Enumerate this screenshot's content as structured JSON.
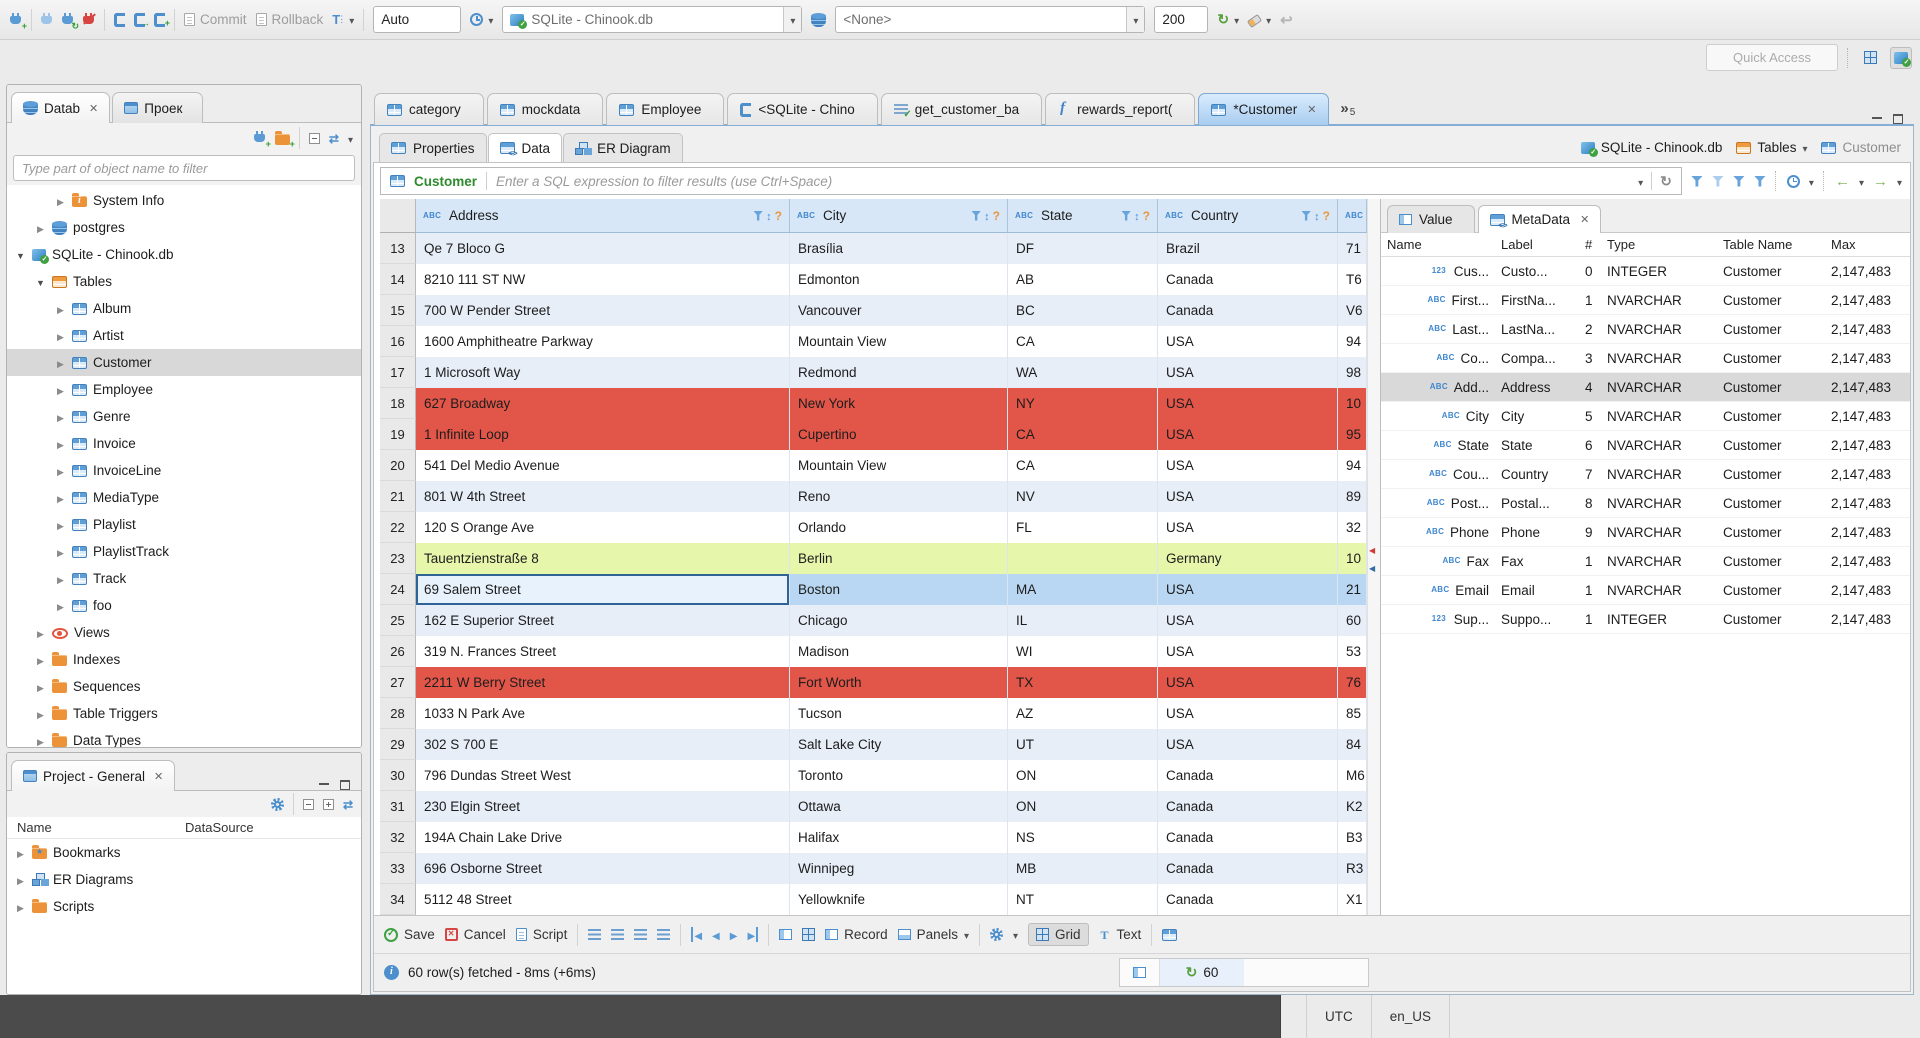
{
  "topbar": {
    "commit_label": "Commit",
    "rollback_label": "Rollback",
    "tx_mode_value": "Auto",
    "connection_value": "SQLite - Chinook.db",
    "schema_value": "<None>",
    "fetch_size_value": "200",
    "quick_access_placeholder": "Quick Access"
  },
  "left": {
    "tabs": [
      {
        "label": "Datab",
        "icon": "db",
        "cls": "active",
        "close": "✕"
      },
      {
        "label": "Проек",
        "icon": "win",
        "cls": "",
        "close": ""
      }
    ],
    "filter_placeholder": "Type part of object name to filter",
    "tree": [
      {
        "label": "System Info",
        "icon": "folder-info",
        "cls": "ind2",
        "exp": "collapsed"
      },
      {
        "label": "postgres",
        "icon": "db",
        "cls": "ind1",
        "exp": "collapsed"
      },
      {
        "label": "SQLite - Chinook.db",
        "icon": "dbfile",
        "cls": "ind0",
        "exp": "expanded"
      },
      {
        "label": "Tables",
        "icon": "folder-table",
        "cls": "ind1",
        "exp": "expanded"
      },
      {
        "label": "Album",
        "icon": "table",
        "cls": "ind2",
        "exp": "collapsed"
      },
      {
        "label": "Artist",
        "icon": "table",
        "cls": "ind2",
        "exp": "collapsed"
      },
      {
        "label": "Customer",
        "icon": "table",
        "cls": "ind2 selected",
        "exp": "collapsed"
      },
      {
        "label": "Employee",
        "icon": "table",
        "cls": "ind2",
        "exp": "collapsed"
      },
      {
        "label": "Genre",
        "icon": "table",
        "cls": "ind2",
        "exp": "collapsed"
      },
      {
        "label": "Invoice",
        "icon": "table",
        "cls": "ind2",
        "exp": "collapsed"
      },
      {
        "label": "InvoiceLine",
        "icon": "table",
        "cls": "ind2",
        "exp": "collapsed"
      },
      {
        "label": "MediaType",
        "icon": "table",
        "cls": "ind2",
        "exp": "collapsed"
      },
      {
        "label": "Playlist",
        "icon": "table",
        "cls": "ind2",
        "exp": "collapsed"
      },
      {
        "label": "PlaylistTrack",
        "icon": "table",
        "cls": "ind2",
        "exp": "collapsed"
      },
      {
        "label": "Track",
        "icon": "table",
        "cls": "ind2",
        "exp": "collapsed"
      },
      {
        "label": "foo",
        "icon": "table",
        "cls": "ind2",
        "exp": "collapsed"
      },
      {
        "label": "Views",
        "icon": "eye",
        "cls": "ind1",
        "exp": "collapsed"
      },
      {
        "label": "Indexes",
        "icon": "folder",
        "cls": "ind1",
        "exp": "collapsed"
      },
      {
        "label": "Sequences",
        "icon": "folder",
        "cls": "ind1",
        "exp": "collapsed"
      },
      {
        "label": "Table Triggers",
        "icon": "folder",
        "cls": "ind1",
        "exp": "collapsed"
      },
      {
        "label": "Data Types",
        "icon": "folder",
        "cls": "ind1",
        "exp": "collapsed"
      }
    ]
  },
  "project": {
    "tab_label": "Project - General",
    "tab_close": "✕",
    "col_name": "Name",
    "col_datasource": "DataSource",
    "items": [
      {
        "label": "Bookmarks",
        "icon": "folder-star",
        "exp": "collapsed"
      },
      {
        "label": "ER Diagrams",
        "icon": "diagram",
        "exp": "collapsed"
      },
      {
        "label": "Scripts",
        "icon": "folder",
        "exp": "collapsed"
      }
    ]
  },
  "editor": {
    "tabs": [
      {
        "label": "category",
        "icon": "table",
        "cls": "",
        "close": ""
      },
      {
        "label": "mockdata",
        "icon": "table",
        "cls": "",
        "close": ""
      },
      {
        "label": "Employee",
        "icon": "table",
        "cls": "",
        "close": ""
      },
      {
        "label": "<SQLite - Chino",
        "icon": "sql",
        "cls": "",
        "close": ""
      },
      {
        "label": "get_customer_ba",
        "icon": "script-check",
        "cls": "",
        "close": ""
      },
      {
        "label": "rewards_report(",
        "icon": "function",
        "cls": "",
        "close": ""
      },
      {
        "label": "*Customer",
        "icon": "table",
        "cls": "active",
        "close": "✕"
      }
    ],
    "overflow_count": "5",
    "subtabs": [
      {
        "label": "Properties",
        "icon": "table",
        "cls": ""
      },
      {
        "label": "Data",
        "icon": "data",
        "cls": "active"
      },
      {
        "label": "ER Diagram",
        "icon": "diagram",
        "cls": ""
      }
    ],
    "breadcrumb": [
      {
        "label": "SQLite - Chinook.db",
        "icon": "dbfile",
        "cls": "",
        "caretcls": ""
      },
      {
        "label": "Tables",
        "icon": "folder-table",
        "cls": "",
        "caretcls": "show"
      },
      {
        "label": "Customer",
        "icon": "table",
        "cls": "muted",
        "caretcls": ""
      }
    ]
  },
  "datagrid": {
    "entity_label": "Customer",
    "filter_placeholder": "Enter a SQL expression to filter results (use Ctrl+Space)",
    "columns": [
      {
        "label": "Address",
        "cls": "c-addr"
      },
      {
        "label": "City",
        "cls": "c-city"
      },
      {
        "label": "State",
        "cls": "c-state"
      },
      {
        "label": "Country",
        "cls": "c-country"
      },
      {
        "label": "",
        "cls": "c-postal nofilter"
      }
    ],
    "rows": [
      {
        "num": "13",
        "address": "Qe 7 Bloco G",
        "city": "Brasília",
        "state": "DF",
        "country": "Brazil",
        "postal": "71",
        "cls": "alt"
      },
      {
        "num": "14",
        "address": "8210 111 ST NW",
        "city": "Edmonton",
        "state": "AB",
        "country": "Canada",
        "postal": "T6",
        "cls": ""
      },
      {
        "num": "15",
        "address": "700 W Pender Street",
        "city": "Vancouver",
        "state": "BC",
        "country": "Canada",
        "postal": "V6",
        "cls": "alt"
      },
      {
        "num": "16",
        "address": "1600 Amphitheatre Parkway",
        "city": "Mountain View",
        "state": "CA",
        "country": "USA",
        "postal": "94",
        "cls": ""
      },
      {
        "num": "17",
        "address": "1 Microsoft Way",
        "city": "Redmond",
        "state": "WA",
        "country": "USA",
        "postal": "98",
        "cls": "alt"
      },
      {
        "num": "18",
        "address": "627 Broadway",
        "city": "New York",
        "state": "NY",
        "country": "USA",
        "postal": "10",
        "cls": "red"
      },
      {
        "num": "19",
        "address": "1 Infinite Loop",
        "city": "Cupertino",
        "state": "CA",
        "country": "USA",
        "postal": "95",
        "cls": "red"
      },
      {
        "num": "20",
        "address": "541 Del Medio Avenue",
        "city": "Mountain View",
        "state": "CA",
        "country": "USA",
        "postal": "94",
        "cls": ""
      },
      {
        "num": "21",
        "address": "801 W 4th Street",
        "city": "Reno",
        "state": "NV",
        "country": "USA",
        "postal": "89",
        "cls": "alt"
      },
      {
        "num": "22",
        "address": "120 S Orange Ave",
        "city": "Orlando",
        "state": "FL",
        "country": "USA",
        "postal": "32",
        "cls": ""
      },
      {
        "num": "23",
        "address": "Tauentzienstraße 8",
        "city": "Berlin",
        "state": "",
        "country": "Germany",
        "postal": "10",
        "cls": "green"
      },
      {
        "num": "24",
        "address": "69 Salem Street",
        "city": "Boston",
        "state": "MA",
        "country": "USA",
        "postal": "21",
        "cls": "sel"
      },
      {
        "num": "25",
        "address": "162 E Superior Street",
        "city": "Chicago",
        "state": "IL",
        "country": "USA",
        "postal": "60",
        "cls": "alt"
      },
      {
        "num": "26",
        "address": "319 N. Frances Street",
        "city": "Madison",
        "state": "WI",
        "country": "USA",
        "postal": "53",
        "cls": ""
      },
      {
        "num": "27",
        "address": "2211 W Berry Street",
        "city": "Fort Worth",
        "state": "TX",
        "country": "USA",
        "postal": "76",
        "cls": "red"
      },
      {
        "num": "28",
        "address": "1033 N Park Ave",
        "city": "Tucson",
        "state": "AZ",
        "country": "USA",
        "postal": "85",
        "cls": ""
      },
      {
        "num": "29",
        "address": "302 S 700 E",
        "city": "Salt Lake City",
        "state": "UT",
        "country": "USA",
        "postal": "84",
        "cls": "alt"
      },
      {
        "num": "30",
        "address": "796 Dundas Street West",
        "city": "Toronto",
        "state": "ON",
        "country": "Canada",
        "postal": "M6",
        "cls": ""
      },
      {
        "num": "31",
        "address": "230 Elgin Street",
        "city": "Ottawa",
        "state": "ON",
        "country": "Canada",
        "postal": "K2",
        "cls": "alt"
      },
      {
        "num": "32",
        "address": "194A Chain Lake Drive",
        "city": "Halifax",
        "state": "NS",
        "country": "Canada",
        "postal": "B3",
        "cls": ""
      },
      {
        "num": "33",
        "address": "696 Osborne Street",
        "city": "Winnipeg",
        "state": "MB",
        "country": "Canada",
        "postal": "R3",
        "cls": "alt"
      },
      {
        "num": "34",
        "address": "5112 48 Street",
        "city": "Yellowknife",
        "state": "NT",
        "country": "Canada",
        "postal": "X1",
        "cls": ""
      }
    ],
    "toolbar": {
      "save": "Save",
      "cancel": "Cancel",
      "script": "Script",
      "record": "Record",
      "panels": "Panels",
      "grid": "Grid",
      "text": "Text"
    },
    "status_message": "60 row(s) fetched - 8ms (+6ms)",
    "fetch_count": "60"
  },
  "metadata": {
    "tabs": [
      {
        "label": "Value",
        "icon": "panelv",
        "cls": "",
        "close": ""
      },
      {
        "label": "MetaData",
        "icon": "data",
        "cls": "active",
        "close": "✕"
      }
    ],
    "columns": {
      "name": "Name",
      "label": "Label",
      "num": "#",
      "type": "Type",
      "table": "Table Name",
      "max": "Max"
    },
    "rows": [
      {
        "icon": "num123",
        "name": "Cus...",
        "label": "Custo...",
        "num": "0",
        "type": "INTEGER",
        "table": "Customer",
        "max": "2,147,483",
        "cls": ""
      },
      {
        "icon": "abc",
        "name": "First...",
        "label": "FirstNa...",
        "num": "1",
        "type": "NVARCHAR",
        "table": "Customer",
        "max": "2,147,483",
        "cls": ""
      },
      {
        "icon": "abc",
        "name": "Last...",
        "label": "LastNa...",
        "num": "2",
        "type": "NVARCHAR",
        "table": "Customer",
        "max": "2,147,483",
        "cls": ""
      },
      {
        "icon": "abc",
        "name": "Co...",
        "label": "Compa...",
        "num": "3",
        "type": "NVARCHAR",
        "table": "Customer",
        "max": "2,147,483",
        "cls": ""
      },
      {
        "icon": "abc",
        "name": "Add...",
        "label": "Address",
        "num": "4",
        "type": "NVARCHAR",
        "table": "Customer",
        "max": "2,147,483",
        "cls": "sel"
      },
      {
        "icon": "abc",
        "name": "City",
        "label": "City",
        "num": "5",
        "type": "NVARCHAR",
        "table": "Customer",
        "max": "2,147,483",
        "cls": ""
      },
      {
        "icon": "abc",
        "name": "State",
        "label": "State",
        "num": "6",
        "type": "NVARCHAR",
        "table": "Customer",
        "max": "2,147,483",
        "cls": ""
      },
      {
        "icon": "abc",
        "name": "Cou...",
        "label": "Country",
        "num": "7",
        "type": "NVARCHAR",
        "table": "Customer",
        "max": "2,147,483",
        "cls": ""
      },
      {
        "icon": "abc",
        "name": "Post...",
        "label": "Postal...",
        "num": "8",
        "type": "NVARCHAR",
        "table": "Customer",
        "max": "2,147,483",
        "cls": ""
      },
      {
        "icon": "abc",
        "name": "Phone",
        "label": "Phone",
        "num": "9",
        "type": "NVARCHAR",
        "table": "Customer",
        "max": "2,147,483",
        "cls": ""
      },
      {
        "icon": "abc",
        "name": "Fax",
        "label": "Fax",
        "num": "1",
        "type": "NVARCHAR",
        "table": "Customer",
        "max": "2,147,483",
        "cls": ""
      },
      {
        "icon": "abc",
        "name": "Email",
        "label": "Email",
        "num": "1",
        "type": "NVARCHAR",
        "table": "Customer",
        "max": "2,147,483",
        "cls": ""
      },
      {
        "icon": "num123",
        "name": "Sup...",
        "label": "Suppo...",
        "num": "1",
        "type": "INTEGER",
        "table": "Customer",
        "max": "2,147,483",
        "cls": ""
      }
    ]
  },
  "statusbar": {
    "timezone": "UTC",
    "locale": "en_US"
  }
}
